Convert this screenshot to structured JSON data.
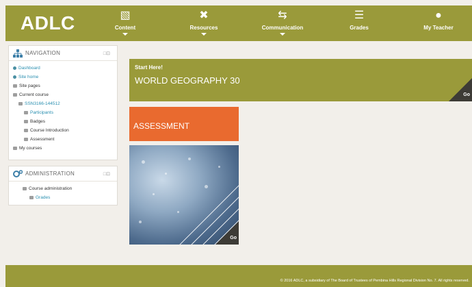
{
  "header": {
    "logo": "ADLC",
    "nav": [
      {
        "label": "Content",
        "icon": "book-icon",
        "glyph": "▧",
        "has_menu": true
      },
      {
        "label": "Resources",
        "icon": "tools-icon",
        "glyph": "✖",
        "has_menu": true
      },
      {
        "label": "Communication",
        "icon": "arrows-icon",
        "glyph": "⇆",
        "has_menu": true
      },
      {
        "label": "Grades",
        "icon": "list-icon",
        "glyph": "☰",
        "has_menu": false
      },
      {
        "label": "My Teacher",
        "icon": "apple-icon",
        "glyph": "●",
        "has_menu": false
      }
    ]
  },
  "navigation_block": {
    "title": "NAVIGATION",
    "controls": "□⊡",
    "items": [
      {
        "label": "Dashboard"
      },
      {
        "label": "Site home"
      },
      {
        "label": "Site pages"
      },
      {
        "label": "Current course"
      },
      {
        "label": "SSN3166-144512"
      },
      {
        "label": "Participants"
      },
      {
        "label": "Badges"
      },
      {
        "label": "Course Introduction"
      },
      {
        "label": "Assessment"
      },
      {
        "label": "My courses"
      }
    ]
  },
  "admin_block": {
    "title": "ADMINISTRATION",
    "controls": "□⊡",
    "items": [
      {
        "label": "Course administration"
      },
      {
        "label": "Grades"
      }
    ]
  },
  "main": {
    "banner": {
      "small": "Start Here!",
      "title": "WORLD GEOGRAPHY 30",
      "go": "Go"
    },
    "assessment": {
      "title": "ASSESSMENT"
    },
    "photo_tile": {
      "go": "Go"
    }
  },
  "footer": {
    "copyright": "© 2016 ADLC, a subsidiary of The Board of Trustees of Pembina Hills Regional Division No. 7. All rights reserved."
  },
  "colors": {
    "olive": "#9a9a3a",
    "orange": "#e96a2f",
    "link": "#2a8fb0",
    "dark": "#3d3b36"
  }
}
